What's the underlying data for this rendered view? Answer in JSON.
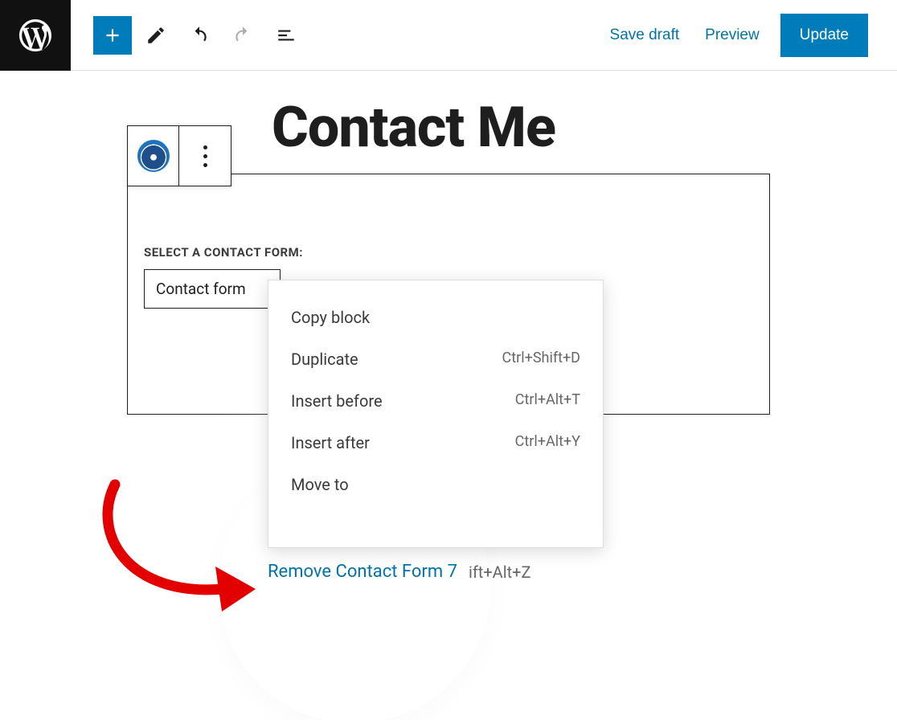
{
  "toolbar": {
    "save_draft": "Save draft",
    "preview": "Preview",
    "update": "Update"
  },
  "page": {
    "title": "Contact Me"
  },
  "block": {
    "select_label": "SELECT A CONTACT FORM:",
    "select_value": "Contact form"
  },
  "menu": {
    "items": [
      {
        "label": "Copy block",
        "shortcut": ""
      },
      {
        "label": "Duplicate",
        "shortcut": "Ctrl+Shift+D"
      },
      {
        "label": "Insert before",
        "shortcut": "Ctrl+Alt+T"
      },
      {
        "label": "Insert after",
        "shortcut": "Ctrl+Alt+Y"
      },
      {
        "label": "Move to",
        "shortcut": ""
      }
    ],
    "remove_label": "Remove Contact Form 7",
    "remove_shortcut": "ift+Alt+Z"
  }
}
